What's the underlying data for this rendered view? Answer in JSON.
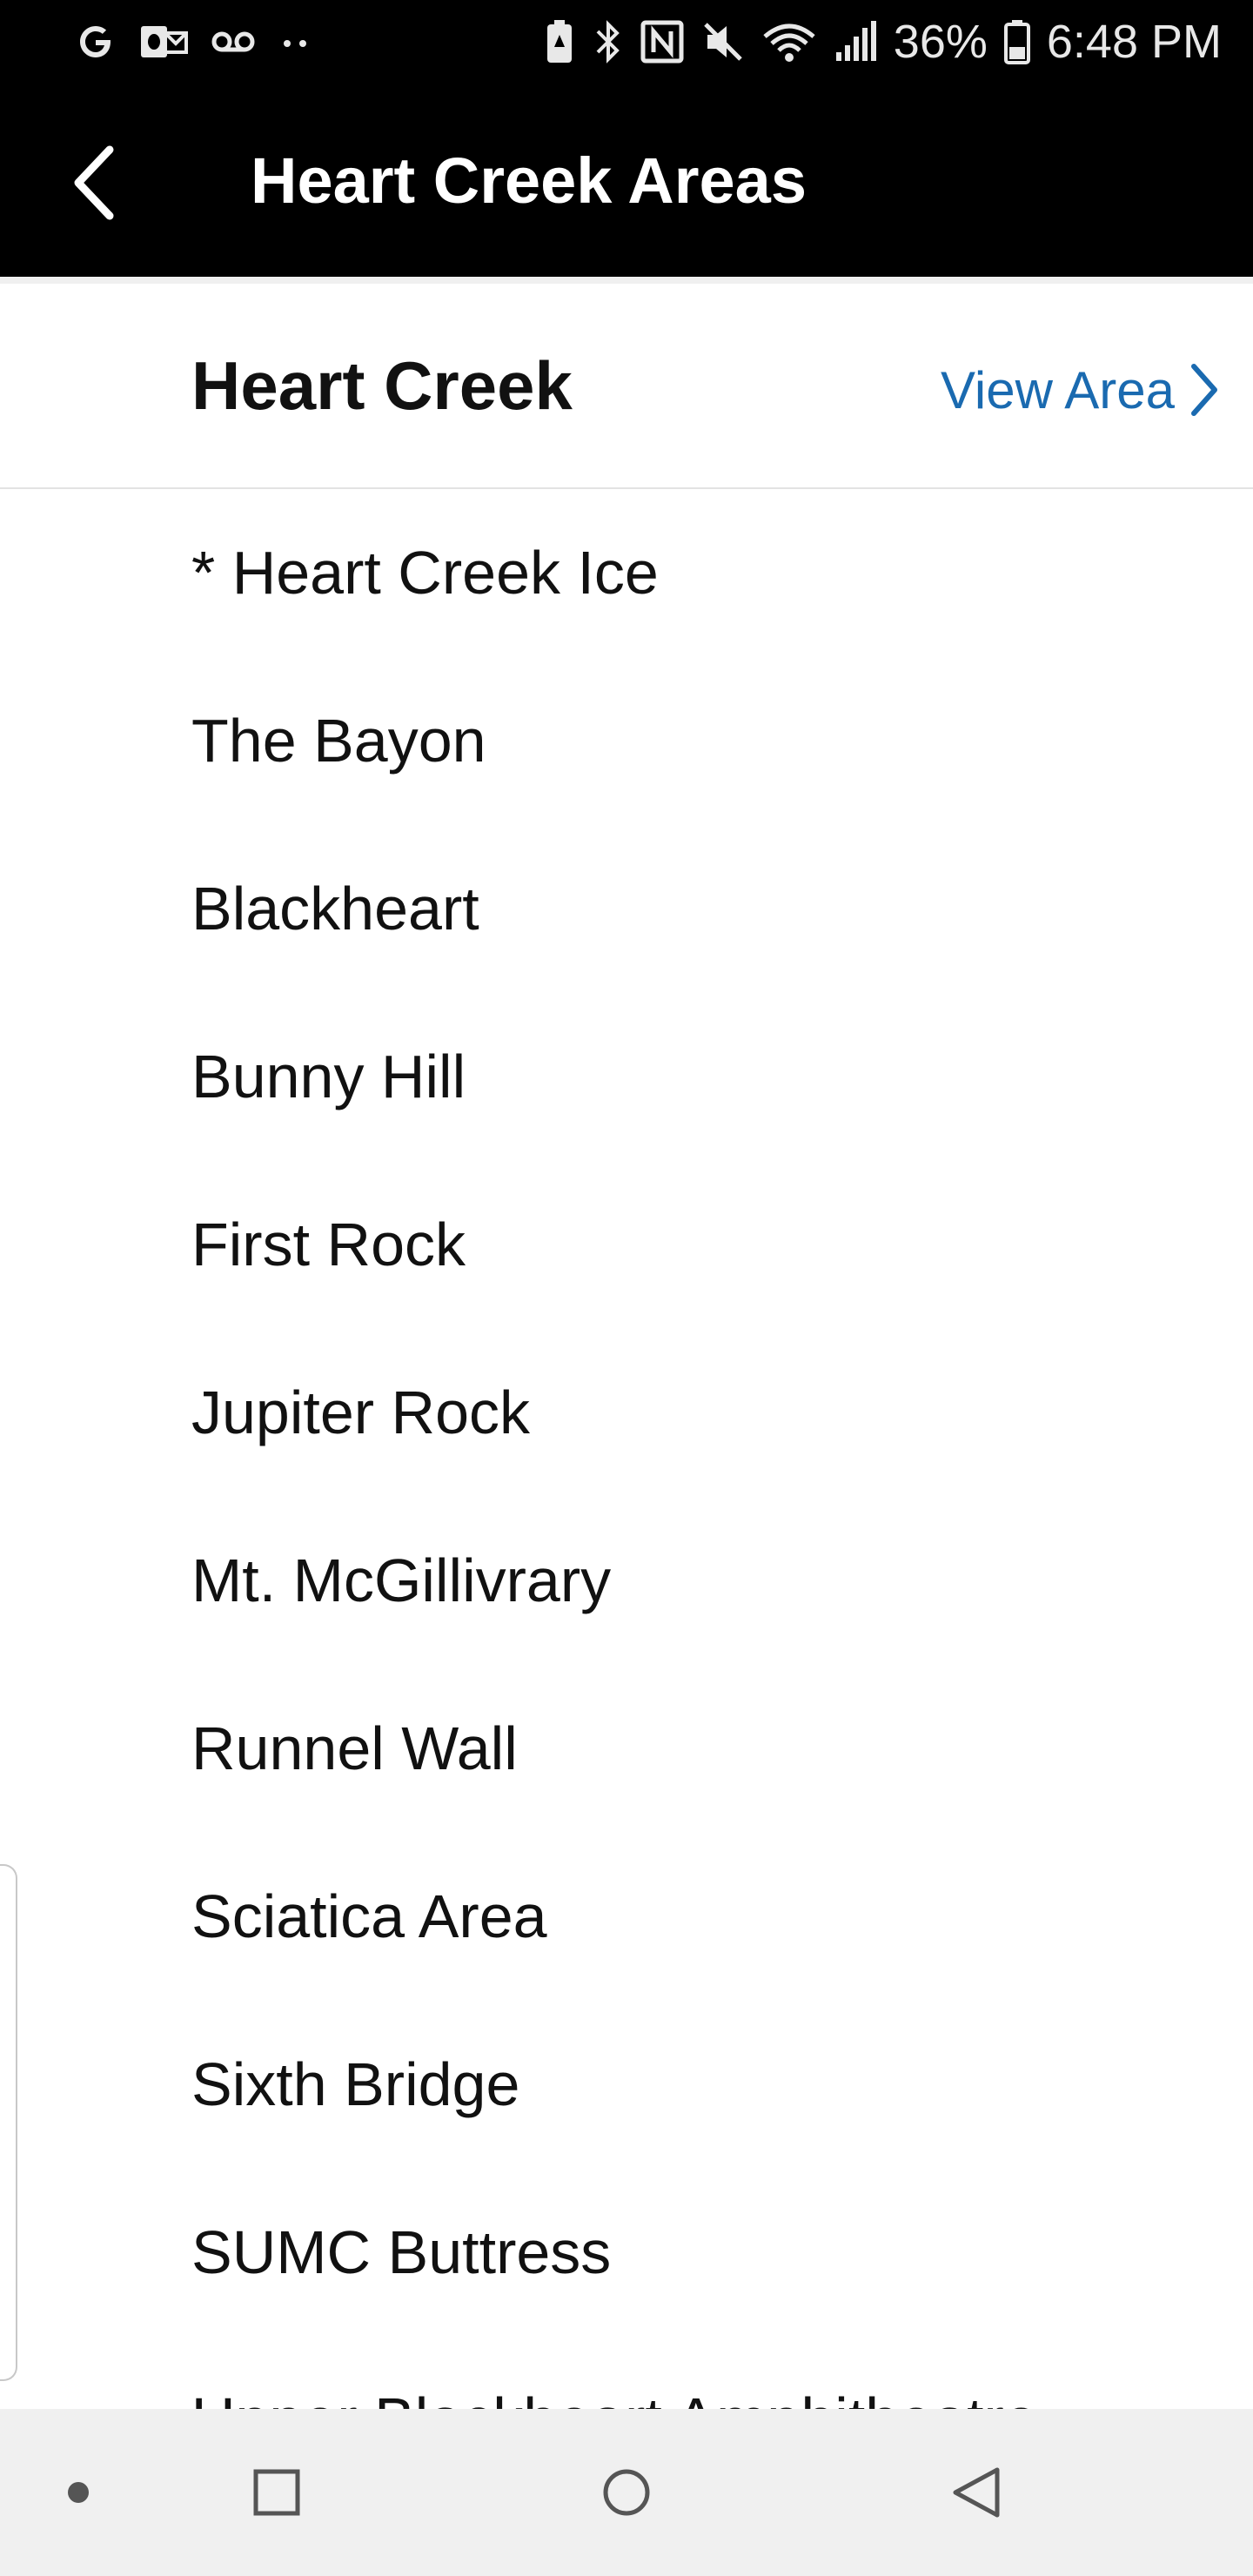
{
  "status_bar": {
    "left_icons": [
      "google-icon",
      "outlook-icon",
      "voicemail-icon",
      "more-notifications-icon"
    ],
    "right_icons": [
      "battery-saver-icon",
      "bluetooth-icon",
      "nfc-icon",
      "mute-icon",
      "wifi-icon",
      "signal-icon"
    ],
    "battery": "36%",
    "time": "6:48 PM"
  },
  "app_bar": {
    "title": "Heart Creek Areas",
    "back_icon": "chevron-left-icon"
  },
  "header": {
    "title": "Heart Creek",
    "view_area": "View Area",
    "accent_color": "#1a6ab0"
  },
  "areas": [
    "* Heart Creek Ice",
    "The Bayon",
    "Blackheart",
    "Bunny Hill",
    "First Rock",
    "Jupiter Rock",
    "Mt. McGillivrary",
    "Runnel Wall",
    "Sciatica Area",
    "Sixth Bridge",
    "SUMC Buttress"
  ],
  "partial_area": "Upper Blackheart Amphitheatre",
  "nav_bar": {
    "buttons": [
      "dot-icon",
      "recents-icon",
      "home-icon",
      "back-triangle-icon"
    ]
  }
}
